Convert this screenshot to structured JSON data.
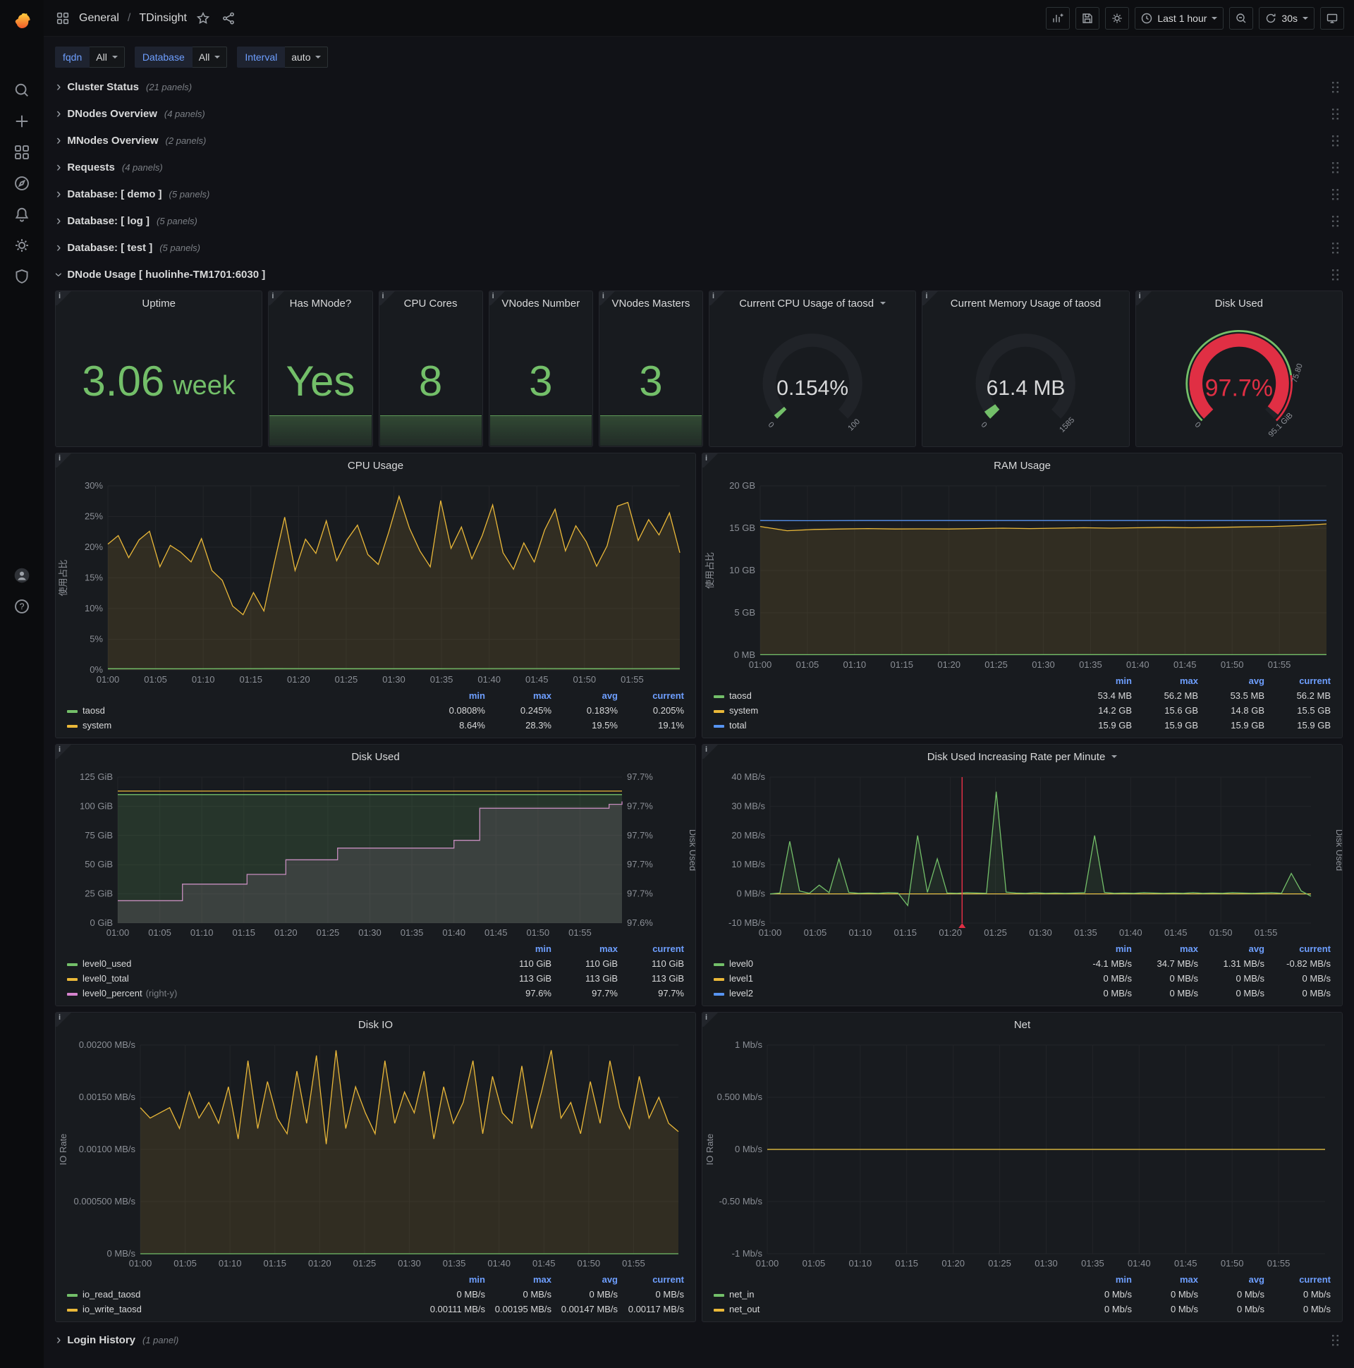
{
  "nav": {
    "section": "General",
    "separator": "/",
    "title": "TDinsight",
    "time_range": "Last 1 hour",
    "refresh_interval": "30s"
  },
  "variables": [
    {
      "label": "fqdn",
      "value": "All"
    },
    {
      "label": "Database",
      "value": "All"
    },
    {
      "label": "Interval",
      "value": "auto"
    }
  ],
  "collapsed_rows": [
    {
      "title": "Cluster Status",
      "count": "(21 panels)"
    },
    {
      "title": "DNodes Overview",
      "count": "(4 panels)"
    },
    {
      "title": "MNodes Overview",
      "count": "(2 panels)"
    },
    {
      "title": "Requests",
      "count": "(4 panels)"
    },
    {
      "title": "Database: [ demo ]",
      "count": "(5 panels)"
    },
    {
      "title": "Database: [ log ]",
      "count": "(5 panels)"
    },
    {
      "title": "Database: [ test ]",
      "count": "(5 panels)"
    }
  ],
  "expanded_row": {
    "title": "DNode Usage [ huolinhe-TM1701:6030 ]"
  },
  "login_row": {
    "title": "Login History",
    "count": "(1 panel)"
  },
  "stat_panels": [
    {
      "title": "Uptime",
      "value": "3.06",
      "unit": "week",
      "sparkline": false
    },
    {
      "title": "Has MNode?",
      "value": "Yes",
      "sparkline": true
    },
    {
      "title": "CPU Cores",
      "value": "8",
      "sparkline": true
    },
    {
      "title": "VNodes Number",
      "value": "3",
      "sparkline": true
    },
    {
      "title": "VNodes Masters",
      "value": "3",
      "sparkline": true
    }
  ],
  "gauge_panels": [
    {
      "title": "Current CPU Usage of taosd",
      "has_menu": true,
      "value": "0.154%",
      "min_label": "0",
      "max_label": "100",
      "fraction": 0.0154,
      "bar_color": "#73bf69",
      "value_color": "#d8d9da",
      "value_size": 30
    },
    {
      "title": "Current Memory Usage of taosd",
      "has_menu": false,
      "value": "61.4 MB",
      "min_label": "0",
      "max_label": "1585",
      "fraction": 0.0387,
      "bar_color": "#73bf69",
      "value_color": "#d8d9da",
      "value_size": 30
    },
    {
      "title": "Disk Used",
      "has_menu": false,
      "value": "97.7%",
      "min_label": "0",
      "max_label": "95.1 GiB",
      "threshold_label": "75.80",
      "threshold_fraction": 0.8,
      "fraction": 0.977,
      "bar_color": "#e02f44",
      "value_color": "#e02f44",
      "value_size": 34
    }
  ],
  "chart_data": [
    {
      "type": "line",
      "row": 1,
      "title": "CPU Usage",
      "ylabel": "使用占比",
      "ml": 74,
      "mr": 22,
      "ylim": [
        0,
        30
      ],
      "yticks": [
        {
          "v": 0,
          "label": "0%"
        },
        {
          "v": 5,
          "label": "5%"
        },
        {
          "v": 10,
          "label": "10%"
        },
        {
          "v": 15,
          "label": "15%"
        },
        {
          "v": 20,
          "label": "20%"
        },
        {
          "v": 25,
          "label": "25%"
        },
        {
          "v": 30,
          "label": "30%"
        }
      ],
      "xlabels": [
        "01:00",
        "01:05",
        "01:10",
        "01:15",
        "01:20",
        "01:25",
        "01:30",
        "01:35",
        "01:40",
        "01:45",
        "01:50",
        "01:55"
      ],
      "series": [
        {
          "name": "system",
          "color": "#eab839",
          "fill": 0.12,
          "values": [
            20.5,
            21.9,
            18.3,
            21.2,
            22.6,
            16.8,
            20.3,
            19.2,
            17.6,
            21.4,
            16.2,
            14.6,
            10.4,
            9.0,
            12.6,
            9.6,
            17.4,
            24.9,
            16.2,
            21.3,
            19.0,
            24.3,
            17.8,
            21.2,
            23.6,
            18.8,
            17.2,
            22.4,
            28.3,
            23.1,
            19.4,
            16.8,
            27.6,
            19.8,
            23.3,
            18.1,
            21.9,
            26.9,
            19.1,
            16.4,
            20.7,
            17.6,
            22.8,
            26.2,
            19.4,
            23.5,
            20.9,
            16.9,
            20.2,
            26.7,
            27.3,
            21.1,
            24.5,
            22.0,
            25.6,
            19.1
          ]
        },
        {
          "name": "taosd",
          "color": "#73bf69",
          "fill": 0.1,
          "values": [
            0.2,
            0.18,
            0.21,
            0.19,
            0.2,
            0.22,
            0.19,
            0.21
          ]
        }
      ],
      "legend": {
        "columns": [
          "min",
          "max",
          "avg",
          "current"
        ],
        "rows": [
          {
            "name": "taosd",
            "color": "#73bf69",
            "values": [
              "0.0808%",
              "0.245%",
              "0.183%",
              "0.205%"
            ]
          },
          {
            "name": "system",
            "color": "#eab839",
            "values": [
              "8.64%",
              "28.3%",
              "19.5%",
              "19.1%"
            ]
          }
        ]
      }
    },
    {
      "type": "line",
      "row": 1,
      "title": "RAM Usage",
      "ylabel": "使用占比",
      "ml": 82,
      "mr": 22,
      "ylim": [
        0,
        20
      ],
      "yticks": [
        {
          "v": 0,
          "label": "0 MB"
        },
        {
          "v": 5,
          "label": "5 GB"
        },
        {
          "v": 10,
          "label": "10 GB"
        },
        {
          "v": 15,
          "label": "15 GB"
        },
        {
          "v": 20,
          "label": "20 GB"
        }
      ],
      "xlabels": [
        "01:00",
        "01:05",
        "01:10",
        "01:15",
        "01:20",
        "01:25",
        "01:30",
        "01:35",
        "01:40",
        "01:45",
        "01:50",
        "01:55"
      ],
      "series": [
        {
          "name": "system",
          "color": "#eab839",
          "fill": 0.12,
          "values": [
            15.2,
            14.7,
            14.85,
            14.9,
            14.95,
            14.9,
            14.92,
            14.9,
            14.95,
            15.0,
            14.95,
            15.0,
            15.05,
            15.0,
            15.05,
            15.1,
            15.05,
            15.1,
            15.15,
            15.2,
            15.3,
            15.5
          ]
        },
        {
          "name": "total",
          "color": "#5794f2",
          "fill": 0,
          "values": [
            15.9,
            15.88,
            15.9,
            15.9,
            15.9,
            15.9,
            15.9,
            15.9,
            15.9,
            15.9,
            15.9,
            15.92
          ]
        },
        {
          "name": "taosd",
          "color": "#73bf69",
          "fill": 0.1,
          "values": [
            0.053,
            0.054,
            0.053,
            0.055,
            0.054,
            0.056
          ]
        }
      ],
      "legend": {
        "columns": [
          "min",
          "max",
          "avg",
          "current"
        ],
        "rows": [
          {
            "name": "taosd",
            "color": "#73bf69",
            "values": [
              "53.4 MB",
              "56.2 MB",
              "53.5 MB",
              "56.2 MB"
            ]
          },
          {
            "name": "system",
            "color": "#eab839",
            "values": [
              "14.2 GB",
              "15.6 GB",
              "14.8 GB",
              "15.5 GB"
            ]
          },
          {
            "name": "total",
            "color": "#5794f2",
            "values": [
              "15.9 GB",
              "15.9 GB",
              "15.9 GB",
              "15.9 GB"
            ]
          }
        ]
      }
    },
    {
      "type": "line",
      "row": 2,
      "title": "Disk Used",
      "ml": 88,
      "mr": 104,
      "y2label": "Disk Used",
      "ylim": [
        0,
        125
      ],
      "yticks": [
        {
          "v": 0,
          "label": "0 GiB"
        },
        {
          "v": 25,
          "label": "25 GiB"
        },
        {
          "v": 50,
          "label": "50 GiB"
        },
        {
          "v": 75,
          "label": "75 GiB"
        },
        {
          "v": 100,
          "label": "100 GiB"
        },
        {
          "v": 125,
          "label": "125 GiB"
        }
      ],
      "y2lim": [
        97.575,
        97.725
      ],
      "y2ticks": [
        {
          "v": 97.575,
          "label": "97.6%"
        },
        {
          "v": 97.605,
          "label": "97.7%"
        },
        {
          "v": 97.635,
          "label": "97.7%"
        },
        {
          "v": 97.665,
          "label": "97.7%"
        },
        {
          "v": 97.695,
          "label": "97.7%"
        },
        {
          "v": 97.725,
          "label": "97.7%"
        }
      ],
      "xlabels": [
        "01:00",
        "01:05",
        "01:10",
        "01:15",
        "01:20",
        "01:25",
        "01:30",
        "01:35",
        "01:40",
        "01:45",
        "01:50",
        "01:55"
      ],
      "series": [
        {
          "name": "level0_percent",
          "color": "#d683ce",
          "axis": "right",
          "step": true,
          "fill": 0.14,
          "values": [
            97.598,
            97.598,
            97.598,
            97.598,
            97.598,
            97.615,
            97.615,
            97.615,
            97.615,
            97.615,
            97.625,
            97.625,
            97.625,
            97.64,
            97.64,
            97.64,
            97.64,
            97.652,
            97.652,
            97.652,
            97.652,
            97.652,
            97.652,
            97.652,
            97.652,
            97.652,
            97.66,
            97.66,
            97.693,
            97.693,
            97.693,
            97.693,
            97.693,
            97.693,
            97.693,
            97.693,
            97.693,
            97.693,
            97.697,
            97.7
          ]
        },
        {
          "name": "level0_used",
          "color": "#73bf69",
          "fill": 0.16,
          "values": [
            110,
            110,
            110,
            110
          ]
        },
        {
          "name": "level0_total",
          "color": "#eab839",
          "fill": 0,
          "values": [
            113,
            113,
            113,
            113
          ]
        }
      ],
      "legend": {
        "columns": [
          "min",
          "max",
          "current"
        ],
        "rows": [
          {
            "name": "level0_used",
            "color": "#73bf69",
            "values": [
              "110 GiB",
              "110 GiB",
              "110 GiB"
            ]
          },
          {
            "name": "level0_total",
            "color": "#eab839",
            "values": [
              "113 GiB",
              "113 GiB",
              "113 GiB"
            ]
          },
          {
            "name": "level0_percent",
            "color": "#d683ce",
            "note": "(right-y)",
            "values": [
              "97.6%",
              "97.7%",
              "97.7%"
            ]
          }
        ]
      }
    },
    {
      "type": "line",
      "row": 2,
      "title": "Disk Used Increasing Rate per Minute",
      "has_menu": true,
      "ml": 96,
      "mr": 44,
      "y2label": "Disk Used",
      "ylim": [
        -10,
        40
      ],
      "yticks": [
        {
          "v": -10,
          "label": "-10 MB/s"
        },
        {
          "v": 0,
          "label": "0 MB/s"
        },
        {
          "v": 10,
          "label": "10 MB/s"
        },
        {
          "v": 20,
          "label": "20 MB/s"
        },
        {
          "v": 30,
          "label": "30 MB/s"
        },
        {
          "v": 40,
          "label": "40 MB/s"
        }
      ],
      "xlabels": [
        "01:00",
        "01:05",
        "01:10",
        "01:15",
        "01:20",
        "01:25",
        "01:30",
        "01:35",
        "01:40",
        "01:45",
        "01:50",
        "01:55"
      ],
      "annotations": [
        {
          "x": 0.355,
          "color": "#e02f44"
        }
      ],
      "series": [
        {
          "name": "level2",
          "color": "#5794f2",
          "fill": 0,
          "values": [
            0,
            0
          ]
        },
        {
          "name": "level1",
          "color": "#eab839",
          "fill": 0,
          "values": [
            0,
            0
          ]
        },
        {
          "name": "level0",
          "color": "#73bf69",
          "fill": 0.1,
          "values": [
            0,
            0.3,
            18,
            1,
            0.2,
            3,
            0.4,
            12,
            0.5,
            0.2,
            0.3,
            0.2,
            0.4,
            0.3,
            -4,
            20,
            0.5,
            12,
            0.3,
            0.2,
            0.4,
            0.3,
            0.2,
            35,
            0.6,
            0.3,
            0.2,
            0.4,
            0.2,
            0.3,
            0.2,
            0.3,
            0.4,
            20,
            0.5,
            0.2,
            0.3,
            0.2,
            0.4,
            0.3,
            0.2,
            0.3,
            0.2,
            0.4,
            0.2,
            0.3,
            0.2,
            0.4,
            0.3,
            0.2,
            0.3,
            0.4,
            0.2,
            7,
            1,
            -0.8
          ]
        }
      ],
      "legend": {
        "columns": [
          "min",
          "max",
          "avg",
          "current"
        ],
        "rows": [
          {
            "name": "level0",
            "color": "#73bf69",
            "values": [
              "-4.1 MB/s",
              "34.7 MB/s",
              "1.31 MB/s",
              "-0.82 MB/s"
            ]
          },
          {
            "name": "level1",
            "color": "#eab839",
            "values": [
              "0 MB/s",
              "0 MB/s",
              "0 MB/s",
              "0 MB/s"
            ]
          },
          {
            "name": "level2",
            "color": "#5794f2",
            "values": [
              "0 MB/s",
              "0 MB/s",
              "0 MB/s",
              "0 MB/s"
            ]
          }
        ]
      }
    },
    {
      "type": "line",
      "row": 3,
      "title": "Disk IO",
      "ylabel": "IO Rate",
      "ml": 120,
      "mr": 24,
      "ylim": [
        0,
        0.002
      ],
      "yticks": [
        {
          "v": 0,
          "label": "0 MB/s"
        },
        {
          "v": 0.0005,
          "label": "0.000500 MB/s"
        },
        {
          "v": 0.001,
          "label": "0.00100 MB/s"
        },
        {
          "v": 0.0015,
          "label": "0.00150 MB/s"
        },
        {
          "v": 0.002,
          "label": "0.00200 MB/s"
        }
      ],
      "xlabels": [
        "01:00",
        "01:05",
        "01:10",
        "01:15",
        "01:20",
        "01:25",
        "01:30",
        "01:35",
        "01:40",
        "01:45",
        "01:50",
        "01:55"
      ],
      "series": [
        {
          "name": "io_write_taosd",
          "color": "#eab839",
          "fill": 0.12,
          "values": [
            0.0014,
            0.0013,
            0.00135,
            0.0014,
            0.0012,
            0.00155,
            0.0013,
            0.00145,
            0.00125,
            0.0016,
            0.0011,
            0.00185,
            0.0012,
            0.00165,
            0.0013,
            0.00115,
            0.00175,
            0.00125,
            0.0019,
            0.00105,
            0.00195,
            0.0012,
            0.0016,
            0.00135,
            0.00115,
            0.00185,
            0.00125,
            0.00155,
            0.00135,
            0.00175,
            0.0011,
            0.0016,
            0.00125,
            0.00145,
            0.00185,
            0.00115,
            0.0017,
            0.00135,
            0.00125,
            0.0018,
            0.0012,
            0.00155,
            0.00195,
            0.0013,
            0.00145,
            0.00115,
            0.00165,
            0.00125,
            0.00185,
            0.0014,
            0.0012,
            0.0017,
            0.0013,
            0.0015,
            0.00125,
            0.00117
          ]
        },
        {
          "name": "io_read_taosd",
          "color": "#73bf69",
          "fill": 0,
          "values": [
            0,
            0
          ]
        }
      ],
      "legend": {
        "columns": [
          "min",
          "max",
          "avg",
          "current"
        ],
        "rows": [
          {
            "name": "io_read_taosd",
            "color": "#73bf69",
            "values": [
              "0 MB/s",
              "0 MB/s",
              "0 MB/s",
              "0 MB/s"
            ]
          },
          {
            "name": "io_write_taosd",
            "color": "#eab839",
            "values": [
              "0.00111 MB/s",
              "0.00195 MB/s",
              "0.00147 MB/s",
              "0.00117 MB/s"
            ]
          }
        ]
      }
    },
    {
      "type": "line",
      "row": 3,
      "title": "Net",
      "ylabel": "IO Rate",
      "ml": 92,
      "mr": 24,
      "ylim": [
        -1,
        1
      ],
      "yticks": [
        {
          "v": -1,
          "label": "-1 Mb/s"
        },
        {
          "v": -0.5,
          "label": "-0.50 Mb/s"
        },
        {
          "v": 0,
          "label": "0 Mb/s"
        },
        {
          "v": 0.5,
          "label": "0.500 Mb/s"
        },
        {
          "v": 1,
          "label": "1 Mb/s"
        }
      ],
      "xlabels": [
        "01:00",
        "01:05",
        "01:10",
        "01:15",
        "01:20",
        "01:25",
        "01:30",
        "01:35",
        "01:40",
        "01:45",
        "01:50",
        "01:55"
      ],
      "series": [
        {
          "name": "net_in",
          "color": "#73bf69",
          "fill": 0,
          "values": [
            0,
            0
          ]
        },
        {
          "name": "net_out",
          "color": "#eab839",
          "fill": 0,
          "values": [
            0,
            0
          ]
        }
      ],
      "legend": {
        "columns": [
          "min",
          "max",
          "avg",
          "current"
        ],
        "rows": [
          {
            "name": "net_in",
            "color": "#73bf69",
            "values": [
              "0 Mb/s",
              "0 Mb/s",
              "0 Mb/s",
              "0 Mb/s"
            ]
          },
          {
            "name": "net_out",
            "color": "#eab839",
            "values": [
              "0 Mb/s",
              "0 Mb/s",
              "0 Mb/s",
              "0 Mb/s"
            ]
          }
        ]
      }
    }
  ]
}
